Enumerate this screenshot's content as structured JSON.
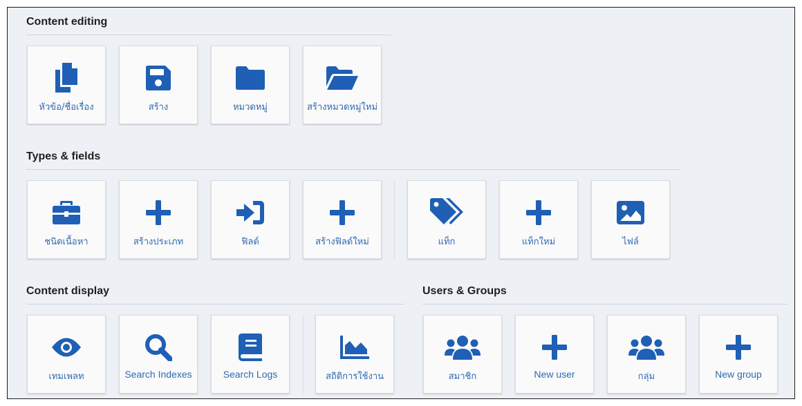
{
  "theme": {
    "icon_color": "#1f5fb5",
    "label_color": "#2f6ab0",
    "background": "#edf1f6"
  },
  "sections": {
    "content_editing": {
      "title": "Content editing",
      "tiles": [
        {
          "label": "หัวข้อ/ชื่อเรื่อง",
          "icon": "copy-icon"
        },
        {
          "label": "สร้าง",
          "icon": "save-icon"
        },
        {
          "label": "หมวดหมู่",
          "icon": "folder-icon"
        },
        {
          "label": "สร้างหมวดหมู่ใหม่",
          "icon": "folder-open-icon"
        }
      ]
    },
    "types_fields": {
      "title": "Types & fields",
      "tiles": [
        {
          "label": "ชนิดเนื้อหา",
          "icon": "toolbox-icon"
        },
        {
          "label": "สร้างประเภท",
          "icon": "plus-icon"
        },
        {
          "label": "ฟิลด์",
          "icon": "sign-in-icon"
        },
        {
          "label": "สร้างฟิลด์ใหม่",
          "icon": "plus-icon"
        },
        {
          "label": "แท็ก",
          "icon": "tags-icon"
        },
        {
          "label": "แท็กใหม่",
          "icon": "plus-icon"
        },
        {
          "label": "ไฟล์",
          "icon": "image-icon"
        }
      ]
    },
    "content_display": {
      "title": "Content display",
      "tiles": [
        {
          "label": "เทมเพลท",
          "icon": "eye-icon"
        },
        {
          "label": "Search Indexes",
          "icon": "search-icon"
        },
        {
          "label": "Search Logs",
          "icon": "book-icon"
        },
        {
          "label": "สถิติการใช้งาน",
          "icon": "area-chart-icon"
        }
      ]
    },
    "users_groups": {
      "title": "Users & Groups",
      "tiles": [
        {
          "label": "สมาชิก",
          "icon": "users-icon"
        },
        {
          "label": "New user",
          "icon": "plus-icon"
        },
        {
          "label": "กลุ่ม",
          "icon": "users-icon"
        },
        {
          "label": "New group",
          "icon": "plus-icon"
        }
      ]
    }
  }
}
